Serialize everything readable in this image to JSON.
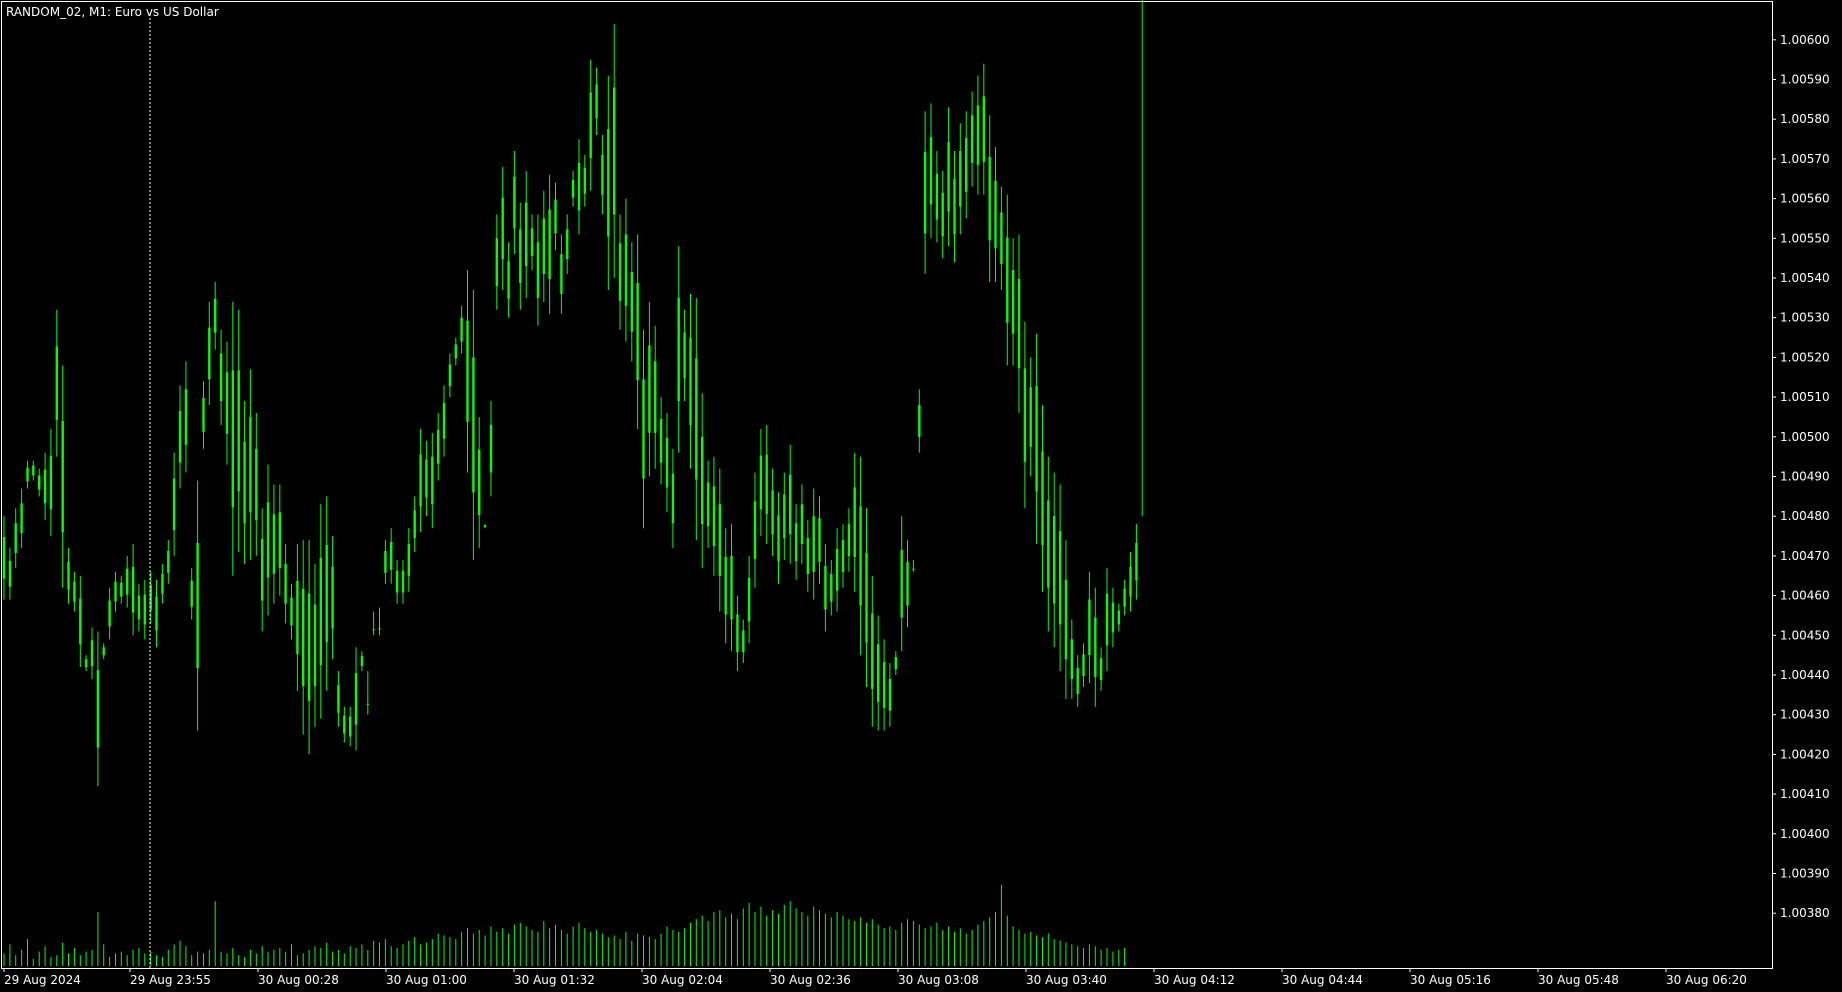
{
  "header": {
    "symbol": "RANDOM_02",
    "timeframe": "M1",
    "description": "Euro vs US Dollar",
    "title_text": "RANDOM_02, M1:  Euro vs US Dollar"
  },
  "colors": {
    "background": "#000000",
    "frame": "#ffffff",
    "candle": "#00ff00",
    "volume": "#00ff00",
    "period_separator": "#ffffff"
  },
  "chart_data": {
    "type": "line",
    "style": "bar-chart-ohlc-high-low",
    "series": [
      {
        "key": "price",
        "x": [
          0,
          5,
          10,
          15,
          20,
          25,
          30,
          35,
          40,
          45,
          50,
          55,
          60,
          65,
          70,
          75,
          80,
          85,
          90,
          95,
          100,
          105,
          110,
          115,
          120,
          125,
          130,
          135,
          140,
          145,
          150,
          155,
          160,
          165,
          170,
          175,
          180,
          185,
          190,
          195,
          200,
          205,
          210,
          215,
          220,
          225,
          230,
          235,
          240,
          245,
          250,
          255,
          260,
          265,
          270,
          275,
          280,
          285,
          290,
          295,
          300,
          305,
          310,
          315,
          320,
          325,
          330,
          335,
          340,
          345,
          350,
          355,
          360,
          365,
          370,
          375,
          380,
          385,
          390,
          395,
          400,
          405,
          410,
          415,
          420,
          425,
          430,
          435,
          440,
          445,
          450,
          455,
          460,
          465,
          470,
          475,
          480,
          485,
          490,
          495,
          500,
          505,
          510,
          515,
          520,
          525,
          530,
          535,
          540,
          545,
          550,
          555,
          560,
          565,
          570,
          575,
          580,
          585,
          590,
          595,
          600,
          605,
          610,
          615,
          620,
          625,
          630,
          635,
          640,
          645,
          650,
          655,
          660,
          665,
          670,
          675,
          680,
          685,
          690,
          695,
          700,
          705,
          710,
          715,
          720,
          725,
          730,
          735,
          740,
          745,
          750,
          755,
          760,
          765,
          770,
          775,
          780,
          785,
          790,
          795,
          800,
          805,
          810,
          815,
          820,
          825,
          830,
          835,
          840,
          845,
          850,
          855,
          860,
          865,
          870,
          875,
          880,
          885,
          890,
          895,
          900,
          905,
          910,
          915,
          920,
          925,
          930,
          935,
          940,
          945,
          950,
          955,
          960,
          965,
          970,
          975,
          980,
          985,
          990,
          995,
          1000,
          1005,
          1010,
          1015,
          1020,
          1025,
          1030,
          1035,
          1040,
          1045,
          1050,
          1055,
          1060,
          1065,
          1070,
          1075,
          1080,
          1085,
          1090,
          1095,
          1100,
          1105,
          1110,
          1115,
          1120,
          1125,
          1130,
          1135,
          1140,
          1145,
          1150,
          1155,
          1160,
          1165,
          1170,
          1175,
          1180,
          1185,
          1190,
          1195,
          1200,
          1205,
          1210,
          1215,
          1220,
          1225,
          1230,
          1235,
          1240,
          1245,
          1250,
          1255,
          1260,
          1265,
          1270,
          1275,
          1280,
          1285,
          1290,
          1295,
          1300,
          1305,
          1310,
          1315,
          1320,
          1325,
          1330,
          1335,
          1340,
          1345,
          1350,
          1355,
          1360,
          1365,
          1370,
          1375,
          1380,
          1385,
          1390,
          1395,
          1400,
          1405,
          1410,
          1415,
          1420,
          1425,
          1430,
          1435,
          1440,
          1445,
          1450,
          1455,
          1460,
          1465,
          1470,
          1475,
          1480,
          1485,
          1490,
          1495,
          1500,
          1505
        ],
        "high": [
          1.0048,
          1.00472,
          1.00482,
          1.00487,
          1.00494,
          1.00494,
          1.00492,
          1.00496,
          1.00502,
          1.00532,
          1.00518,
          1.00472,
          1.00466,
          1.00465,
          1.00445,
          1.00452,
          1.00451,
          1.00448,
          1.00462,
          1.00466,
          1.00465,
          1.0047,
          1.00473,
          1.00463,
          1.00464,
          1.00466,
          1.00464,
          1.00468,
          1.00474,
          1.00496,
          1.00513,
          1.00519,
          1.00467,
          1.00489,
          1.00514,
          1.00534,
          1.00539,
          1.00527,
          1.00524,
          1.00534,
          1.00532,
          1.00509,
          1.00517,
          1.00506,
          1.00482,
          1.00493,
          1.00488,
          1.00488,
          1.00473,
          1.00463,
          1.00473,
          1.00474,
          1.00474,
          1.00468,
          1.00483,
          1.00485,
          1.00475,
          1.00441,
          1.00432,
          1.00432,
          1.00447,
          1.00446,
          1.0043,
          1.0045,
          1.0045,
          1.00474,
          1.00477,
          1.00469,
          1.00469,
          1.00477,
          1.00485,
          1.00502,
          1.00499,
          1.00501,
          1.00506,
          1.00513,
          1.00521,
          1.00525,
          1.00533,
          1.00542,
          1.00537,
          1.00505,
          1.00478,
          1.00509,
          1.00556,
          1.00568,
          1.00549,
          1.00572,
          1.00559,
          1.00567,
          1.00556,
          1.00556,
          1.00562,
          1.00566,
          1.00564,
          1.00551,
          1.00556,
          1.00567,
          1.00575,
          1.00571,
          1.00595,
          1.00593,
          1.00576,
          1.00591,
          1.00604,
          1.00556,
          1.0056,
          1.00549,
          1.00551,
          1.00527,
          1.00534,
          1.00528,
          1.0051,
          1.00506,
          1.00497,
          1.00548,
          1.00532,
          1.00536,
          1.00535,
          1.00511,
          1.00494,
          1.00495,
          1.00492,
          1.00477,
          1.00478,
          1.0046,
          1.00454,
          1.0047,
          1.00491,
          1.00502,
          1.00503,
          1.00492,
          1.00486,
          1.00491,
          1.00498,
          1.00483,
          1.00488,
          1.00479,
          1.00487,
          1.00485,
          1.00473,
          1.00469,
          1.00477,
          1.00478,
          1.00482,
          1.00496,
          1.00495,
          1.00482,
          1.00465,
          1.00455,
          1.00449,
          1.00443,
          1.00446,
          1.0048,
          1.00474,
          1.00466,
          1.00512,
          1.00582,
          1.00584,
          1.00572,
          1.00567,
          1.00583,
          1.00572,
          1.00579,
          1.00582,
          1.00587,
          1.00591,
          1.00594,
          1.00581,
          1.00573,
          1.00563,
          1.00561,
          1.0055,
          1.00551,
          1.00529,
          1.0052,
          1.00526,
          1.00508,
          1.00495,
          1.00491,
          1.00488,
          1.00474,
          1.00454,
          1.00445,
          1.00448,
          1.00466,
          1.00462,
          1.00447,
          1.00467,
          1.00462,
          1.00458,
          1.00464,
          1.00471,
          1.00478,
          1.0048
        ],
        "low": [
          1.00459,
          1.00459,
          1.00467,
          1.00472,
          1.00487,
          1.00489,
          1.00485,
          1.00479,
          1.00475,
          1.00495,
          1.00462,
          1.00458,
          1.00456,
          1.00442,
          1.00441,
          1.00439,
          1.00412,
          1.00444,
          1.00449,
          1.00456,
          1.00458,
          1.00457,
          1.0045,
          1.00451,
          1.00449,
          1.00453,
          1.00447,
          1.00458,
          1.00463,
          1.0047,
          1.00487,
          1.00491,
          1.00454,
          1.00426,
          1.00497,
          1.00508,
          1.00522,
          1.00503,
          1.00493,
          1.00465,
          1.00471,
          1.00468,
          1.00469,
          1.0047,
          1.00451,
          1.00455,
          1.00458,
          1.0046,
          1.00453,
          1.00449,
          1.00436,
          1.00425,
          1.0042,
          1.00427,
          1.00429,
          1.00436,
          1.00444,
          1.00427,
          1.00423,
          1.00422,
          1.00421,
          1.00441,
          1.00441,
          1.00456,
          1.00457,
          1.00463,
          1.00463,
          1.00458,
          1.00458,
          1.00461,
          1.00471,
          1.00476,
          1.0048,
          1.00477,
          1.00489,
          1.00495,
          1.0051,
          1.00518,
          1.00521,
          1.00491,
          1.00469,
          1.00472,
          1.00477,
          1.00485,
          1.00532,
          1.00537,
          1.0053,
          1.00546,
          1.00532,
          1.00535,
          1.00542,
          1.00528,
          1.00534,
          1.00531,
          1.00547,
          1.00531,
          1.00541,
          1.00558,
          1.00551,
          1.00558,
          1.00562,
          1.00576,
          1.00556,
          1.00537,
          1.0054,
          1.00527,
          1.00524,
          1.00519,
          1.00502,
          1.00477,
          1.0049,
          1.00492,
          1.00488,
          1.00481,
          1.00472,
          1.00496,
          1.00509,
          1.00492,
          1.00474,
          1.00467,
          1.00472,
          1.00465,
          1.00456,
          1.00448,
          1.00446,
          1.00441,
          1.00443,
          1.00448,
          1.00462,
          1.00475,
          1.00473,
          1.0047,
          1.00463,
          1.00469,
          1.00468,
          1.00464,
          1.00468,
          1.00461,
          1.00459,
          1.00463,
          1.00451,
          1.00455,
          1.00456,
          1.00462,
          1.00466,
          1.00461,
          1.00445,
          1.00437,
          1.00427,
          1.00426,
          1.00426,
          1.00427,
          1.0044,
          1.00446,
          1.00452,
          1.00469,
          1.00496,
          1.00541,
          1.0055,
          1.00549,
          1.00545,
          1.00548,
          1.00544,
          1.00551,
          1.00555,
          1.00563,
          1.00561,
          1.00561,
          1.00539,
          1.00539,
          1.00537,
          1.00518,
          1.00518,
          1.00506,
          1.00482,
          1.0049,
          1.00473,
          1.00461,
          1.00451,
          1.00447,
          1.00441,
          1.00434,
          1.00434,
          1.00432,
          1.00437,
          1.00438,
          1.00432,
          1.00436,
          1.00441,
          1.00447,
          1.00451,
          1.00455,
          1.00456,
          1.00459
        ]
      },
      {
        "key": "volume",
        "values": [
          7,
          12,
          6,
          9,
          15,
          4,
          8,
          11,
          5,
          6,
          13,
          7,
          10,
          6,
          8,
          9,
          30,
          12,
          5,
          7,
          8,
          6,
          9,
          10,
          7,
          8,
          6,
          5,
          9,
          12,
          14,
          11,
          6,
          8,
          7,
          9,
          36,
          8,
          7,
          10,
          6,
          5,
          9,
          7,
          11,
          8,
          9,
          10,
          8,
          12,
          6,
          7,
          9,
          11,
          10,
          13,
          8,
          9,
          7,
          11,
          10,
          12,
          9,
          14,
          13,
          15,
          11,
          10,
          12,
          14,
          16,
          12,
          13,
          15,
          18,
          17,
          16,
          15,
          19,
          21,
          18,
          20,
          17,
          22,
          19,
          21,
          18,
          23,
          24,
          22,
          20,
          19,
          25,
          21,
          23,
          20,
          18,
          22,
          24,
          21,
          19,
          20,
          18,
          16,
          17,
          15,
          19,
          14,
          18,
          17,
          16,
          15,
          18,
          22,
          20,
          19,
          21,
          24,
          26,
          28,
          25,
          30,
          31,
          27,
          29,
          26,
          32,
          35,
          30,
          33,
          28,
          31,
          29,
          34,
          36,
          32,
          30,
          28,
          33,
          31,
          29,
          27,
          30,
          28,
          26,
          25,
          27,
          24,
          26,
          23,
          21,
          22,
          20,
          24,
          26,
          25,
          23,
          21,
          22,
          24,
          20,
          22,
          19,
          21,
          18,
          20,
          23,
          25,
          27,
          30,
          45,
          28,
          22,
          20,
          18,
          19,
          17,
          16,
          18,
          15,
          14,
          13,
          12,
          11,
          10,
          12,
          11,
          9,
          10,
          8,
          9,
          10
        ]
      }
    ],
    "ylim": [
      1.00372,
      1.00605
    ],
    "yticks": [
      "1.00600",
      "1.00590",
      "1.00580",
      "1.00570",
      "1.00560",
      "1.00550",
      "1.00540",
      "1.00530",
      "1.00520",
      "1.00510",
      "1.00500",
      "1.00490",
      "1.00480",
      "1.00470",
      "1.00460",
      "1.00450",
      "1.00440",
      "1.00430",
      "1.00420",
      "1.00410",
      "1.00400",
      "1.00390",
      "1.00380"
    ],
    "xticks": [
      "29 Aug 2024",
      "29 Aug 23:55",
      "30 Aug 00:28",
      "30 Aug 01:00",
      "30 Aug 01:32",
      "30 Aug 02:04",
      "30 Aug 02:36",
      "30 Aug 03:08",
      "30 Aug 03:40",
      "30 Aug 04:12",
      "30 Aug 04:44",
      "30 Aug 05:16",
      "30 Aug 05:48",
      "30 Aug 06:20"
    ],
    "grid": false,
    "legend": "none"
  }
}
